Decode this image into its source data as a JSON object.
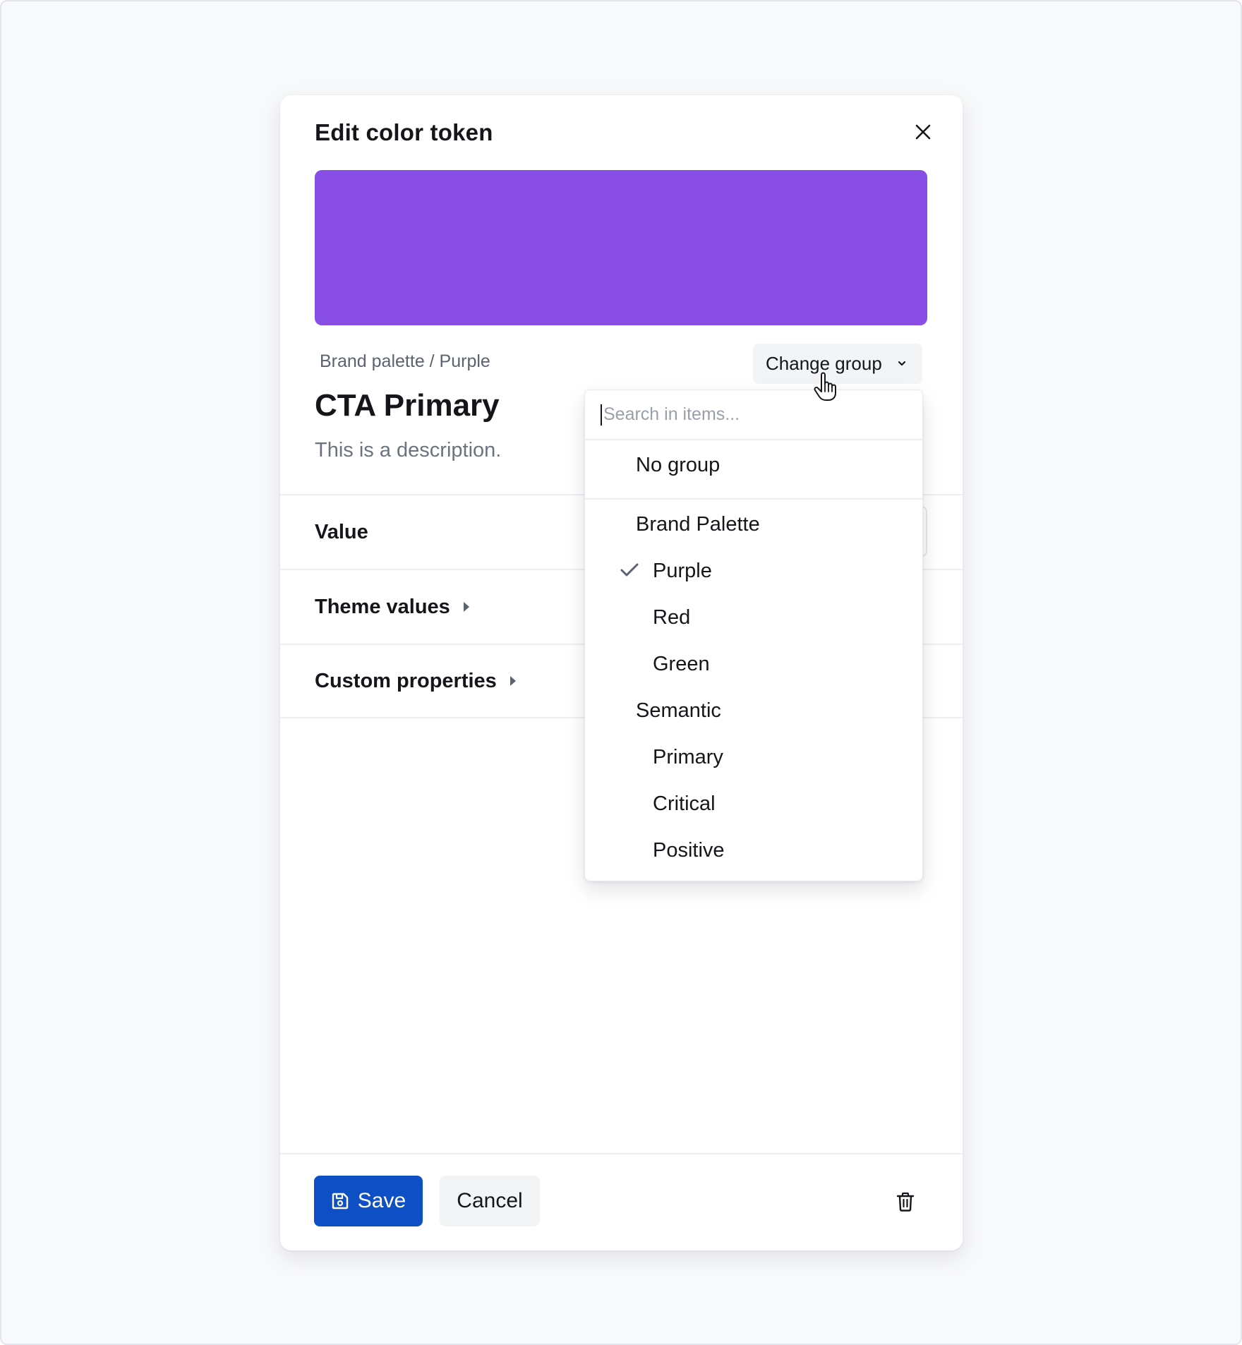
{
  "dialog": {
    "title": "Edit color token",
    "close_icon": "close-icon",
    "swatch_color": "#884ee6",
    "breadcrumb": "Brand palette / Purple",
    "change_group_label": "Change group",
    "token_name": "CTA Primary",
    "description": "This is a description.",
    "sections": {
      "value": "Value",
      "theme_values": "Theme values",
      "custom_properties": "Custom properties"
    },
    "footer": {
      "save_label": "Save",
      "cancel_label": "Cancel",
      "save_icon": "floppy-disk-icon",
      "delete_icon": "trash-icon"
    }
  },
  "dropdown": {
    "search_placeholder": "Search in items...",
    "no_group_label": "No group",
    "groups": [
      {
        "label": "Brand Palette",
        "items": [
          {
            "label": "Purple",
            "selected": true
          },
          {
            "label": "Red",
            "selected": false
          },
          {
            "label": "Green",
            "selected": false
          }
        ]
      },
      {
        "label": "Semantic",
        "items": [
          {
            "label": "Primary",
            "selected": false
          },
          {
            "label": "Critical",
            "selected": false
          },
          {
            "label": "Positive",
            "selected": false
          }
        ]
      }
    ]
  },
  "colors": {
    "accent": "#0f4fc6",
    "swatch": "#884ee6",
    "check": "#5b6270"
  }
}
